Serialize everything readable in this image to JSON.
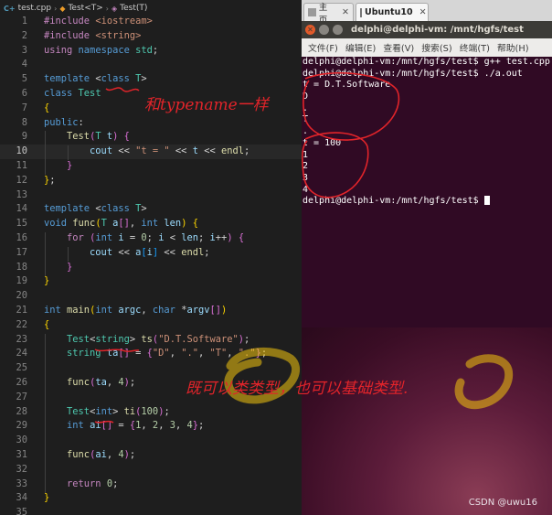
{
  "editor": {
    "breadcrumb": {
      "file": "test.cpp",
      "symbol": "Test<T>",
      "constructor": "Test(T)"
    },
    "current_line": 10,
    "lines": [
      {
        "n": "1",
        "tokens": [
          {
            "t": "#include ",
            "c": "t-pre"
          },
          {
            "t": "<iostream>",
            "c": "t-str"
          }
        ]
      },
      {
        "n": "2",
        "tokens": [
          {
            "t": "#include ",
            "c": "t-pre"
          },
          {
            "t": "<string>",
            "c": "t-str"
          }
        ]
      },
      {
        "n": "3",
        "tokens": [
          {
            "t": "using ",
            "c": "t-ctl"
          },
          {
            "t": "namespace ",
            "c": "t-kw"
          },
          {
            "t": "std",
            "c": "t-type"
          },
          {
            "t": ";",
            "c": "t-plain"
          }
        ]
      },
      {
        "n": "4",
        "tokens": []
      },
      {
        "n": "5",
        "tokens": [
          {
            "t": "template ",
            "c": "t-kw"
          },
          {
            "t": "<",
            "c": "t-plain"
          },
          {
            "t": "class ",
            "c": "t-kw"
          },
          {
            "t": "T",
            "c": "t-type"
          },
          {
            "t": ">",
            "c": "t-plain"
          }
        ]
      },
      {
        "n": "6",
        "tokens": [
          {
            "t": "class ",
            "c": "t-kw"
          },
          {
            "t": "Test",
            "c": "t-type"
          }
        ]
      },
      {
        "n": "7",
        "tokens": [
          {
            "t": "{",
            "c": "t-brace"
          }
        ]
      },
      {
        "n": "8",
        "tokens": [
          {
            "t": "public",
            "c": "t-kw"
          },
          {
            "t": ":",
            "c": "t-plain"
          }
        ]
      },
      {
        "n": "9",
        "tokens": [
          {
            "t": "    ",
            "c": "t-plain"
          },
          {
            "t": "Test",
            "c": "t-fn"
          },
          {
            "t": "(",
            "c": "t-brace2"
          },
          {
            "t": "T ",
            "c": "t-type"
          },
          {
            "t": "t",
            "c": "t-var"
          },
          {
            "t": ")",
            "c": "t-brace2"
          },
          {
            "t": " ",
            "c": "t-plain"
          },
          {
            "t": "{",
            "c": "t-brace2"
          }
        ]
      },
      {
        "n": "10",
        "tokens": [
          {
            "t": "        ",
            "c": "t-plain"
          },
          {
            "t": "cout",
            "c": "t-var"
          },
          {
            "t": " << ",
            "c": "t-plain"
          },
          {
            "t": "\"t = \"",
            "c": "t-str"
          },
          {
            "t": " << ",
            "c": "t-plain"
          },
          {
            "t": "t",
            "c": "t-var"
          },
          {
            "t": " << ",
            "c": "t-plain"
          },
          {
            "t": "endl",
            "c": "t-fn"
          },
          {
            "t": ";",
            "c": "t-plain"
          }
        ]
      },
      {
        "n": "11",
        "tokens": [
          {
            "t": "    ",
            "c": "t-plain"
          },
          {
            "t": "}",
            "c": "t-brace2"
          }
        ]
      },
      {
        "n": "12",
        "tokens": [
          {
            "t": "}",
            "c": "t-brace"
          },
          {
            "t": ";",
            "c": "t-plain"
          }
        ]
      },
      {
        "n": "13",
        "tokens": []
      },
      {
        "n": "14",
        "tokens": [
          {
            "t": "template ",
            "c": "t-kw"
          },
          {
            "t": "<",
            "c": "t-plain"
          },
          {
            "t": "class ",
            "c": "t-kw"
          },
          {
            "t": "T",
            "c": "t-type"
          },
          {
            "t": ">",
            "c": "t-plain"
          }
        ]
      },
      {
        "n": "15",
        "tokens": [
          {
            "t": "void ",
            "c": "t-kw"
          },
          {
            "t": "func",
            "c": "t-fn"
          },
          {
            "t": "(",
            "c": "t-brace"
          },
          {
            "t": "T ",
            "c": "t-type"
          },
          {
            "t": "a",
            "c": "t-var"
          },
          {
            "t": "[]",
            "c": "t-brace2"
          },
          {
            "t": ", ",
            "c": "t-plain"
          },
          {
            "t": "int ",
            "c": "t-kw"
          },
          {
            "t": "len",
            "c": "t-var"
          },
          {
            "t": ")",
            "c": "t-brace"
          },
          {
            "t": " ",
            "c": "t-plain"
          },
          {
            "t": "{",
            "c": "t-brace"
          }
        ]
      },
      {
        "n": "16",
        "tokens": [
          {
            "t": "    ",
            "c": "t-plain"
          },
          {
            "t": "for ",
            "c": "t-ctl"
          },
          {
            "t": "(",
            "c": "t-brace2"
          },
          {
            "t": "int ",
            "c": "t-kw"
          },
          {
            "t": "i",
            "c": "t-var"
          },
          {
            "t": " = ",
            "c": "t-plain"
          },
          {
            "t": "0",
            "c": "t-num"
          },
          {
            "t": "; ",
            "c": "t-plain"
          },
          {
            "t": "i",
            "c": "t-var"
          },
          {
            "t": " < ",
            "c": "t-plain"
          },
          {
            "t": "len",
            "c": "t-var"
          },
          {
            "t": "; ",
            "c": "t-plain"
          },
          {
            "t": "i",
            "c": "t-var"
          },
          {
            "t": "++",
            "c": "t-plain"
          },
          {
            "t": ")",
            "c": "t-brace2"
          },
          {
            "t": " ",
            "c": "t-plain"
          },
          {
            "t": "{",
            "c": "t-brace2"
          }
        ]
      },
      {
        "n": "17",
        "tokens": [
          {
            "t": "        ",
            "c": "t-plain"
          },
          {
            "t": "cout",
            "c": "t-var"
          },
          {
            "t": " << ",
            "c": "t-plain"
          },
          {
            "t": "a",
            "c": "t-var"
          },
          {
            "t": "[",
            "c": "t-brace3"
          },
          {
            "t": "i",
            "c": "t-var"
          },
          {
            "t": "]",
            "c": "t-brace3"
          },
          {
            "t": " << ",
            "c": "t-plain"
          },
          {
            "t": "endl",
            "c": "t-fn"
          },
          {
            "t": ";",
            "c": "t-plain"
          }
        ]
      },
      {
        "n": "18",
        "tokens": [
          {
            "t": "    ",
            "c": "t-plain"
          },
          {
            "t": "}",
            "c": "t-brace2"
          }
        ]
      },
      {
        "n": "19",
        "tokens": [
          {
            "t": "}",
            "c": "t-brace"
          }
        ]
      },
      {
        "n": "20",
        "tokens": []
      },
      {
        "n": "21",
        "tokens": [
          {
            "t": "int ",
            "c": "t-kw"
          },
          {
            "t": "main",
            "c": "t-fn"
          },
          {
            "t": "(",
            "c": "t-brace"
          },
          {
            "t": "int ",
            "c": "t-kw"
          },
          {
            "t": "argc",
            "c": "t-var"
          },
          {
            "t": ", ",
            "c": "t-plain"
          },
          {
            "t": "char ",
            "c": "t-kw"
          },
          {
            "t": "*",
            "c": "t-plain"
          },
          {
            "t": "argv",
            "c": "t-var"
          },
          {
            "t": "[]",
            "c": "t-brace2"
          },
          {
            "t": ")",
            "c": "t-brace"
          }
        ]
      },
      {
        "n": "22",
        "tokens": [
          {
            "t": "{",
            "c": "t-brace"
          }
        ]
      },
      {
        "n": "23",
        "tokens": [
          {
            "t": "    ",
            "c": "t-plain"
          },
          {
            "t": "Test",
            "c": "t-type"
          },
          {
            "t": "<",
            "c": "t-plain"
          },
          {
            "t": "string",
            "c": "t-type"
          },
          {
            "t": ">",
            "c": "t-plain"
          },
          {
            "t": " ",
            "c": "t-plain"
          },
          {
            "t": "ts",
            "c": "t-fn"
          },
          {
            "t": "(",
            "c": "t-brace2"
          },
          {
            "t": "\"D.T.Software\"",
            "c": "t-str"
          },
          {
            "t": ")",
            "c": "t-brace2"
          },
          {
            "t": ";",
            "c": "t-plain"
          }
        ]
      },
      {
        "n": "24",
        "tokens": [
          {
            "t": "    ",
            "c": "t-plain"
          },
          {
            "t": "string ",
            "c": "t-type"
          },
          {
            "t": "ta",
            "c": "t-var"
          },
          {
            "t": "[]",
            "c": "t-brace2"
          },
          {
            "t": " = ",
            "c": "t-plain"
          },
          {
            "t": "{",
            "c": "t-brace2"
          },
          {
            "t": "\"D\"",
            "c": "t-str"
          },
          {
            "t": ", ",
            "c": "t-plain"
          },
          {
            "t": "\".\"",
            "c": "t-str"
          },
          {
            "t": ", ",
            "c": "t-plain"
          },
          {
            "t": "\"T\"",
            "c": "t-str"
          },
          {
            "t": ", ",
            "c": "t-plain"
          },
          {
            "t": "\".\"",
            "c": "t-str"
          },
          {
            "t": "}",
            "c": "t-brace2"
          },
          {
            "t": ";",
            "c": "t-plain"
          }
        ]
      },
      {
        "n": "25",
        "tokens": []
      },
      {
        "n": "26",
        "tokens": [
          {
            "t": "    ",
            "c": "t-plain"
          },
          {
            "t": "func",
            "c": "t-fn"
          },
          {
            "t": "(",
            "c": "t-brace2"
          },
          {
            "t": "ta",
            "c": "t-var"
          },
          {
            "t": ", ",
            "c": "t-plain"
          },
          {
            "t": "4",
            "c": "t-num"
          },
          {
            "t": ")",
            "c": "t-brace2"
          },
          {
            "t": ";",
            "c": "t-plain"
          }
        ]
      },
      {
        "n": "27",
        "tokens": []
      },
      {
        "n": "28",
        "tokens": [
          {
            "t": "    ",
            "c": "t-plain"
          },
          {
            "t": "Test",
            "c": "t-type"
          },
          {
            "t": "<",
            "c": "t-plain"
          },
          {
            "t": "int",
            "c": "t-kw"
          },
          {
            "t": ">",
            "c": "t-plain"
          },
          {
            "t": " ",
            "c": "t-plain"
          },
          {
            "t": "ti",
            "c": "t-fn"
          },
          {
            "t": "(",
            "c": "t-brace2"
          },
          {
            "t": "100",
            "c": "t-num"
          },
          {
            "t": ")",
            "c": "t-brace2"
          },
          {
            "t": ";",
            "c": "t-plain"
          }
        ]
      },
      {
        "n": "29",
        "tokens": [
          {
            "t": "    ",
            "c": "t-plain"
          },
          {
            "t": "int ",
            "c": "t-kw"
          },
          {
            "t": "ai",
            "c": "t-var"
          },
          {
            "t": "[]",
            "c": "t-brace2"
          },
          {
            "t": " = ",
            "c": "t-plain"
          },
          {
            "t": "{",
            "c": "t-brace2"
          },
          {
            "t": "1",
            "c": "t-num"
          },
          {
            "t": ", ",
            "c": "t-plain"
          },
          {
            "t": "2",
            "c": "t-num"
          },
          {
            "t": ", ",
            "c": "t-plain"
          },
          {
            "t": "3",
            "c": "t-num"
          },
          {
            "t": ", ",
            "c": "t-plain"
          },
          {
            "t": "4",
            "c": "t-num"
          },
          {
            "t": "}",
            "c": "t-brace2"
          },
          {
            "t": ";",
            "c": "t-plain"
          }
        ]
      },
      {
        "n": "30",
        "tokens": []
      },
      {
        "n": "31",
        "tokens": [
          {
            "t": "    ",
            "c": "t-plain"
          },
          {
            "t": "func",
            "c": "t-fn"
          },
          {
            "t": "(",
            "c": "t-brace2"
          },
          {
            "t": "ai",
            "c": "t-var"
          },
          {
            "t": ", ",
            "c": "t-plain"
          },
          {
            "t": "4",
            "c": "t-num"
          },
          {
            "t": ")",
            "c": "t-brace2"
          },
          {
            "t": ";",
            "c": "t-plain"
          }
        ]
      },
      {
        "n": "32",
        "tokens": []
      },
      {
        "n": "33",
        "tokens": [
          {
            "t": "    ",
            "c": "t-plain"
          },
          {
            "t": "return ",
            "c": "t-ctl"
          },
          {
            "t": "0",
            "c": "t-num"
          },
          {
            "t": ";",
            "c": "t-plain"
          }
        ]
      },
      {
        "n": "34",
        "tokens": [
          {
            "t": "}",
            "c": "t-brace"
          }
        ]
      },
      {
        "n": "35",
        "tokens": []
      }
    ]
  },
  "terminal": {
    "tabs": [
      {
        "label": "主页",
        "icon": "home-icon",
        "active": false
      },
      {
        "label": "Ubuntu10",
        "icon": "terminal-icon",
        "active": true
      }
    ],
    "title": "delphi@delphi-vm: /mnt/hgfs/test",
    "menu": [
      "文件(F)",
      "编辑(E)",
      "查看(V)",
      "搜索(S)",
      "终端(T)",
      "帮助(H)"
    ],
    "output": [
      "delphi@delphi-vm:/mnt/hgfs/test$ g++ test.cpp",
      "delphi@delphi-vm:/mnt/hgfs/test$ ./a.out",
      "t = D.T.Software",
      "D",
      ".",
      "T",
      ".",
      "t = 100",
      "1",
      "2",
      "3",
      "4"
    ],
    "prompt": "delphi@delphi-vm:/mnt/hgfs/test$ "
  },
  "annotations": {
    "typename_note": "和typename一样",
    "types_note": "既可以类类型，也可以基础类型."
  },
  "watermark": "CSDN @uwu16",
  "colors": {
    "editor_bg": "#1e1e1e",
    "terminal_bg": "#300a24",
    "annotation_red": "#e1242a",
    "highlighter": "#f2c40f"
  }
}
